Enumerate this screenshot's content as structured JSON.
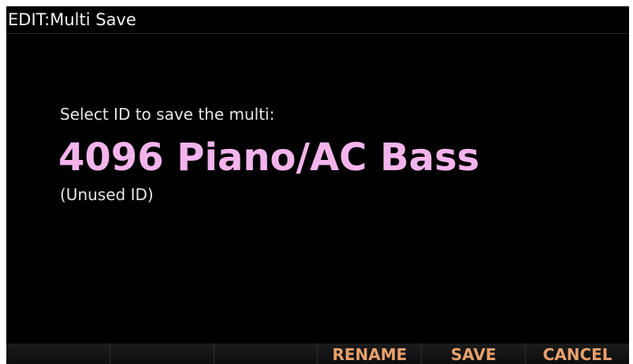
{
  "header": {
    "title": "EDIT:Multi Save"
  },
  "main": {
    "prompt": "Select ID to save the multi:",
    "entry_name": "4096 Piano/AC Bass",
    "entry_status": "(Unused ID)"
  },
  "softkeys": [
    {
      "label": ""
    },
    {
      "label": ""
    },
    {
      "label": ""
    },
    {
      "label": "RENAME"
    },
    {
      "label": "SAVE"
    },
    {
      "label": "CANCEL"
    }
  ],
  "colors": {
    "background": "#000000",
    "highlight_text": "#f3b4ec",
    "softkey_text": "#e8a06c",
    "body_text": "#e6e6e6"
  }
}
